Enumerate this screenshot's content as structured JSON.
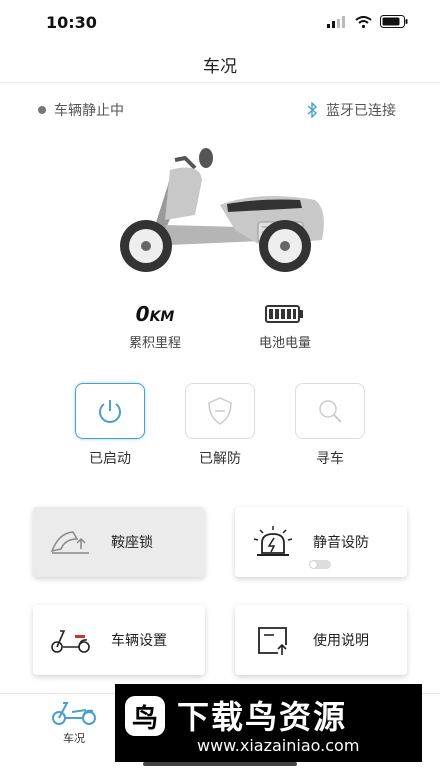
{
  "status_bar": {
    "time": "10:30"
  },
  "nav": {
    "title": "车况"
  },
  "vehicle_status": {
    "state": "车辆静止中",
    "bluetooth": "蓝牙已连接"
  },
  "stats": {
    "mileage_value": "0",
    "mileage_unit": "KM",
    "mileage_label": "累积里程",
    "battery_label": "电池电量",
    "battery_level": 1.0
  },
  "controls": [
    {
      "label": "已启动",
      "icon": "power-icon"
    },
    {
      "label": "已解防",
      "icon": "shield-icon"
    },
    {
      "label": "寻车",
      "icon": "search-icon"
    }
  ],
  "cards": [
    {
      "label": "鞍座锁",
      "icon": "seat-lock-icon"
    },
    {
      "label": "静音设防",
      "icon": "alarm-light-icon",
      "toggle_on": false
    },
    {
      "label": "车辆设置",
      "icon": "scooter-icon"
    },
    {
      "label": "使用说明",
      "icon": "manual-icon"
    }
  ],
  "tabbar": {
    "car_label": "车况"
  },
  "watermark": {
    "title": "下载鸟资源",
    "url": "www.xiazainiao.com",
    "logo_char": "鸟"
  },
  "colors": {
    "accent": "#4a9fd1",
    "scooter_body": "#c8c8c8"
  }
}
